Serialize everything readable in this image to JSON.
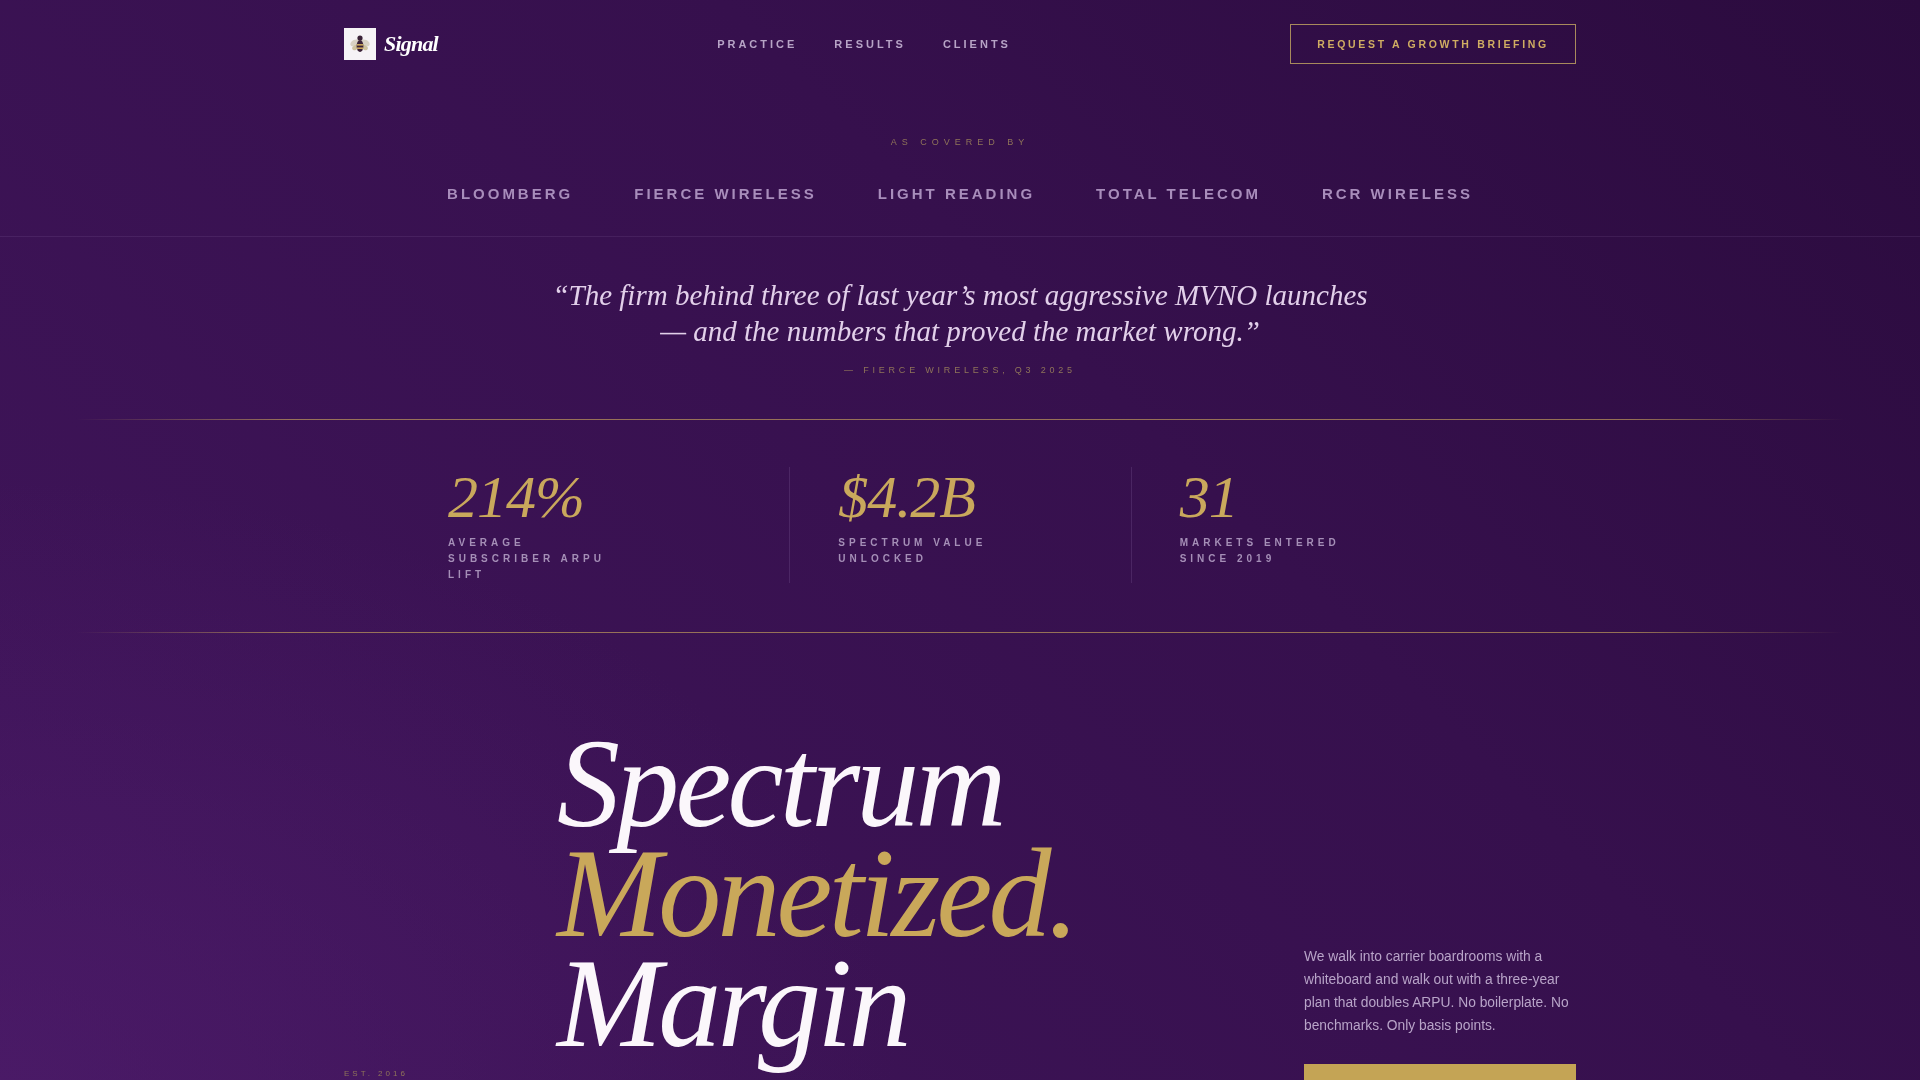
{
  "header": {
    "brand": "Signal",
    "nav": [
      {
        "label": "PRACTICE"
      },
      {
        "label": "RESULTS"
      },
      {
        "label": "CLIENTS"
      }
    ],
    "cta": "REQUEST A GROWTH BRIEFING"
  },
  "press": {
    "eyebrow": "AS COVERED BY",
    "outlets": [
      "BLOOMBERG",
      "FIERCE WIRELESS",
      "LIGHT READING",
      "TOTAL TELECOM",
      "RCR WIRELESS"
    ]
  },
  "quote": {
    "text": "“The firm behind three of last year’s most aggressive MVNO launches — and the numbers that proved the market wrong.”",
    "attribution": "— FIERCE WIRELESS, Q3 2025"
  },
  "stats": [
    {
      "value": "214%",
      "label": "AVERAGE SUBSCRIBER ARPU LIFT"
    },
    {
      "value": "$4.2B",
      "label": "SPECTRUM VALUE UNLOCKED"
    },
    {
      "value": "31",
      "label": "MARKETS ENTERED SINCE 2019"
    }
  ],
  "hero": {
    "lines": [
      {
        "text": "Spectrum",
        "accent": false
      },
      {
        "text": "Monetized.",
        "accent": true
      },
      {
        "text": "Margin",
        "accent": false
      }
    ],
    "established": "EST. 2016",
    "intro": "We walk into carrier boardrooms with a whiteboard and walk out with a three-year plan that doubles ARPU. No boilerplate. No benchmarks. Only basis points."
  }
}
